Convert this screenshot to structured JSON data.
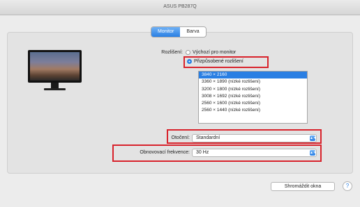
{
  "window": {
    "title": "ASUS PB287Q"
  },
  "tabs": [
    {
      "label": "Monitor",
      "active": true
    },
    {
      "label": "Barva",
      "active": false
    }
  ],
  "resolution": {
    "label": "Rozlišení:",
    "options": [
      {
        "label": "Výchozí pro monitor",
        "selected": false
      },
      {
        "label": "Přizpůsobené rozlišení",
        "selected": true
      }
    ],
    "list": [
      {
        "label": "3840 × 2160",
        "selected": true
      },
      {
        "label": "3360 × 1890 (nízké rozlišení)",
        "selected": false
      },
      {
        "label": "3200 × 1800 (nízké rozlišení)",
        "selected": false
      },
      {
        "label": "3008 × 1692 (nízké rozlišení)",
        "selected": false
      },
      {
        "label": "2560 × 1600 (nízké rozlišení)",
        "selected": false
      },
      {
        "label": "2560 × 1440 (nízké rozlišení)",
        "selected": false
      }
    ]
  },
  "rotation": {
    "label": "Otočení:",
    "value": "Standardní"
  },
  "refresh_rate": {
    "label": "Obnovovací frekvence:",
    "value": "30 Hz"
  },
  "buttons": {
    "gather_windows": "Shromáždit okna",
    "help": "?"
  },
  "colors": {
    "accent": "#2a7fe3",
    "highlight_box": "#d8222b"
  }
}
